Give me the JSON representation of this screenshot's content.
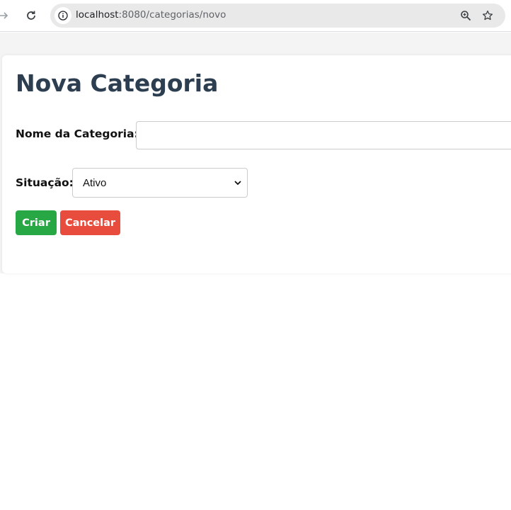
{
  "browser": {
    "url_host": "localhost",
    "url_path": ":8080/categorias/novo",
    "icons": {
      "forward": "arrow-right-icon",
      "reload": "reload-icon",
      "site_info": "info-icon",
      "zoom": "zoom-icon",
      "bookmark": "star-icon"
    }
  },
  "form": {
    "title": "Nova Categoria",
    "nome_label": "Nome da Categoria:",
    "nome_value": "",
    "situacao_label": "Situação:",
    "situacao_value": "Ativo",
    "criar_label": "Criar",
    "cancelar_label": "Cancelar"
  },
  "colors": {
    "title": "#2c3e50",
    "criar_button": "#28a745",
    "cancelar_button": "#e74c3c"
  }
}
